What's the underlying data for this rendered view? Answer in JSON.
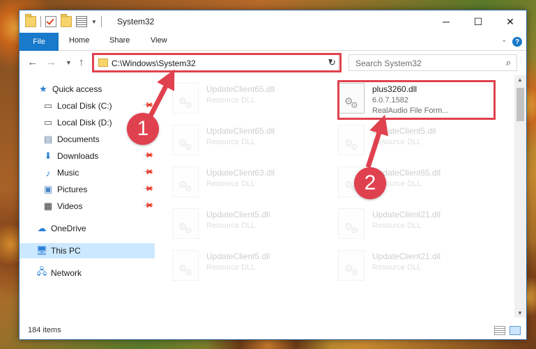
{
  "window": {
    "title": "System32",
    "controls": [
      "─",
      "☐",
      "✕"
    ]
  },
  "ribbon": {
    "tabs": [
      "File",
      "Home",
      "Share",
      "View"
    ],
    "help": "?"
  },
  "address": {
    "path": "C:\\Windows\\System32",
    "search_placeholder": "Search System32"
  },
  "sidebar": {
    "items": [
      {
        "label": "Quick access",
        "icon": "star-icon"
      },
      {
        "label": "Local Disk (C:)",
        "icon": "drive-icon"
      },
      {
        "label": "Local Disk (D:)",
        "icon": "drive-icon"
      },
      {
        "label": "Documents",
        "icon": "documents-icon"
      },
      {
        "label": "Downloads",
        "icon": "download-icon"
      },
      {
        "label": "Music",
        "icon": "music-icon"
      },
      {
        "label": "Pictures",
        "icon": "pictures-icon"
      },
      {
        "label": "Videos",
        "icon": "videos-icon"
      },
      {
        "label": "OneDrive",
        "icon": "cloud-icon"
      },
      {
        "label": "This PC",
        "icon": "computer-icon"
      },
      {
        "label": "Network",
        "icon": "network-icon"
      }
    ]
  },
  "files": {
    "highlighted": {
      "name": "plus3260.dll",
      "version": "6.0.7.1582",
      "description": "RealAudio File Form..."
    },
    "left_column": [
      {
        "name": "UpdateClient65.dll",
        "type": "Resource DLL"
      },
      {
        "name": "UpdateClient65.dll",
        "type": "Resource DLL"
      },
      {
        "name": "UpdateClient63.dll",
        "type": "Resource DLL"
      },
      {
        "name": "UpdateClient5.dll",
        "type": "Resource DLL"
      },
      {
        "name": "UpdateClient5.dll",
        "type": "Resource DLL"
      }
    ],
    "right_column": [
      {
        "name": "UpdateClient5.dll",
        "type": "Resource DLL"
      },
      {
        "name": "UpdateClient65.dll",
        "type": "Resource DLL"
      },
      {
        "name": "UpdateClient21.dll",
        "type": "Resource DLL"
      },
      {
        "name": "UpdateClient21.dll",
        "type": "Resource DLL"
      }
    ]
  },
  "status": {
    "count": "184 items"
  },
  "annotations": {
    "step1": "1",
    "step2": "2",
    "color": "#e0414f"
  }
}
